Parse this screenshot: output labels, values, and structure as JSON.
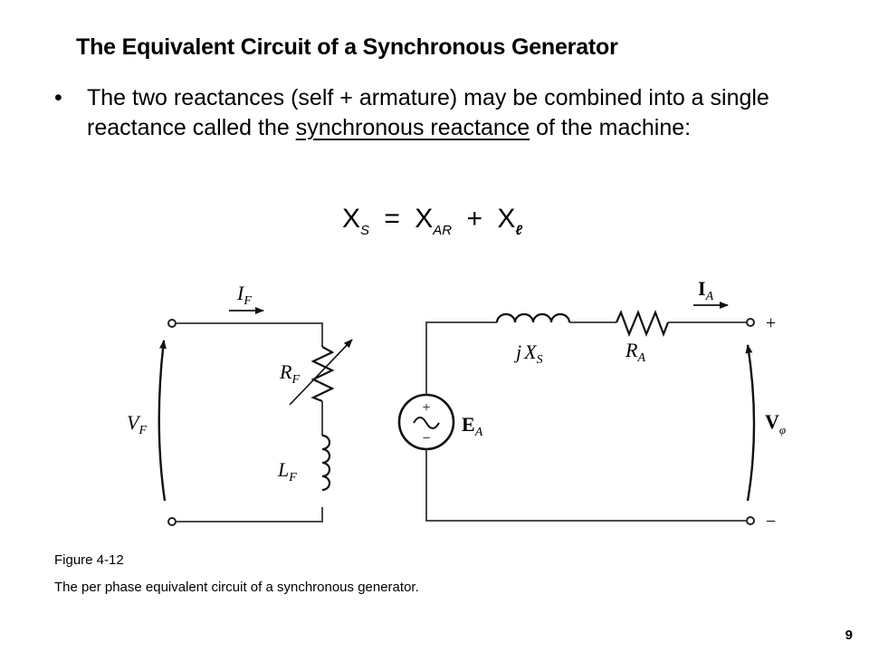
{
  "slide": {
    "title": "The Equivalent Circuit of a Synchronous  Generator",
    "bullet": {
      "marker": "•",
      "text_before": "The  two reactances (self + armature) may be combined into a single reactance called the ",
      "underlined": "synchronous reactance",
      "text_after": " of the machine:"
    },
    "formula": {
      "lhs": "X",
      "lhs_sub": "S",
      "equals": "=",
      "term1": "X",
      "term1_sub": "AR",
      "plus": "+",
      "term2": "X",
      "term2_sub": "ℓ"
    },
    "circuit": {
      "field_current": {
        "symbol": "I",
        "sub": "F"
      },
      "field_voltage": {
        "symbol": "V",
        "sub": "F"
      },
      "field_resistance": {
        "symbol": "R",
        "sub": "F"
      },
      "field_inductance": {
        "symbol": "L",
        "sub": "F"
      },
      "sync_reactance": {
        "prefix": "j",
        "symbol": "X",
        "sub": "S"
      },
      "armature_resistance": {
        "symbol": "R",
        "sub": "A"
      },
      "armature_current": {
        "symbol": "I",
        "sub": "A"
      },
      "internal_voltage": {
        "symbol": "E",
        "sub": "A"
      },
      "phase_voltage": {
        "symbol": "V",
        "sub": "φ"
      },
      "source_plus": "+",
      "source_minus": "−",
      "terminal_plus": "+",
      "terminal_minus": "−"
    },
    "caption": {
      "figure_label": "Figure 4-12",
      "description": "The per phase equivalent circuit of a synchronous generator."
    },
    "page_number": "9"
  }
}
